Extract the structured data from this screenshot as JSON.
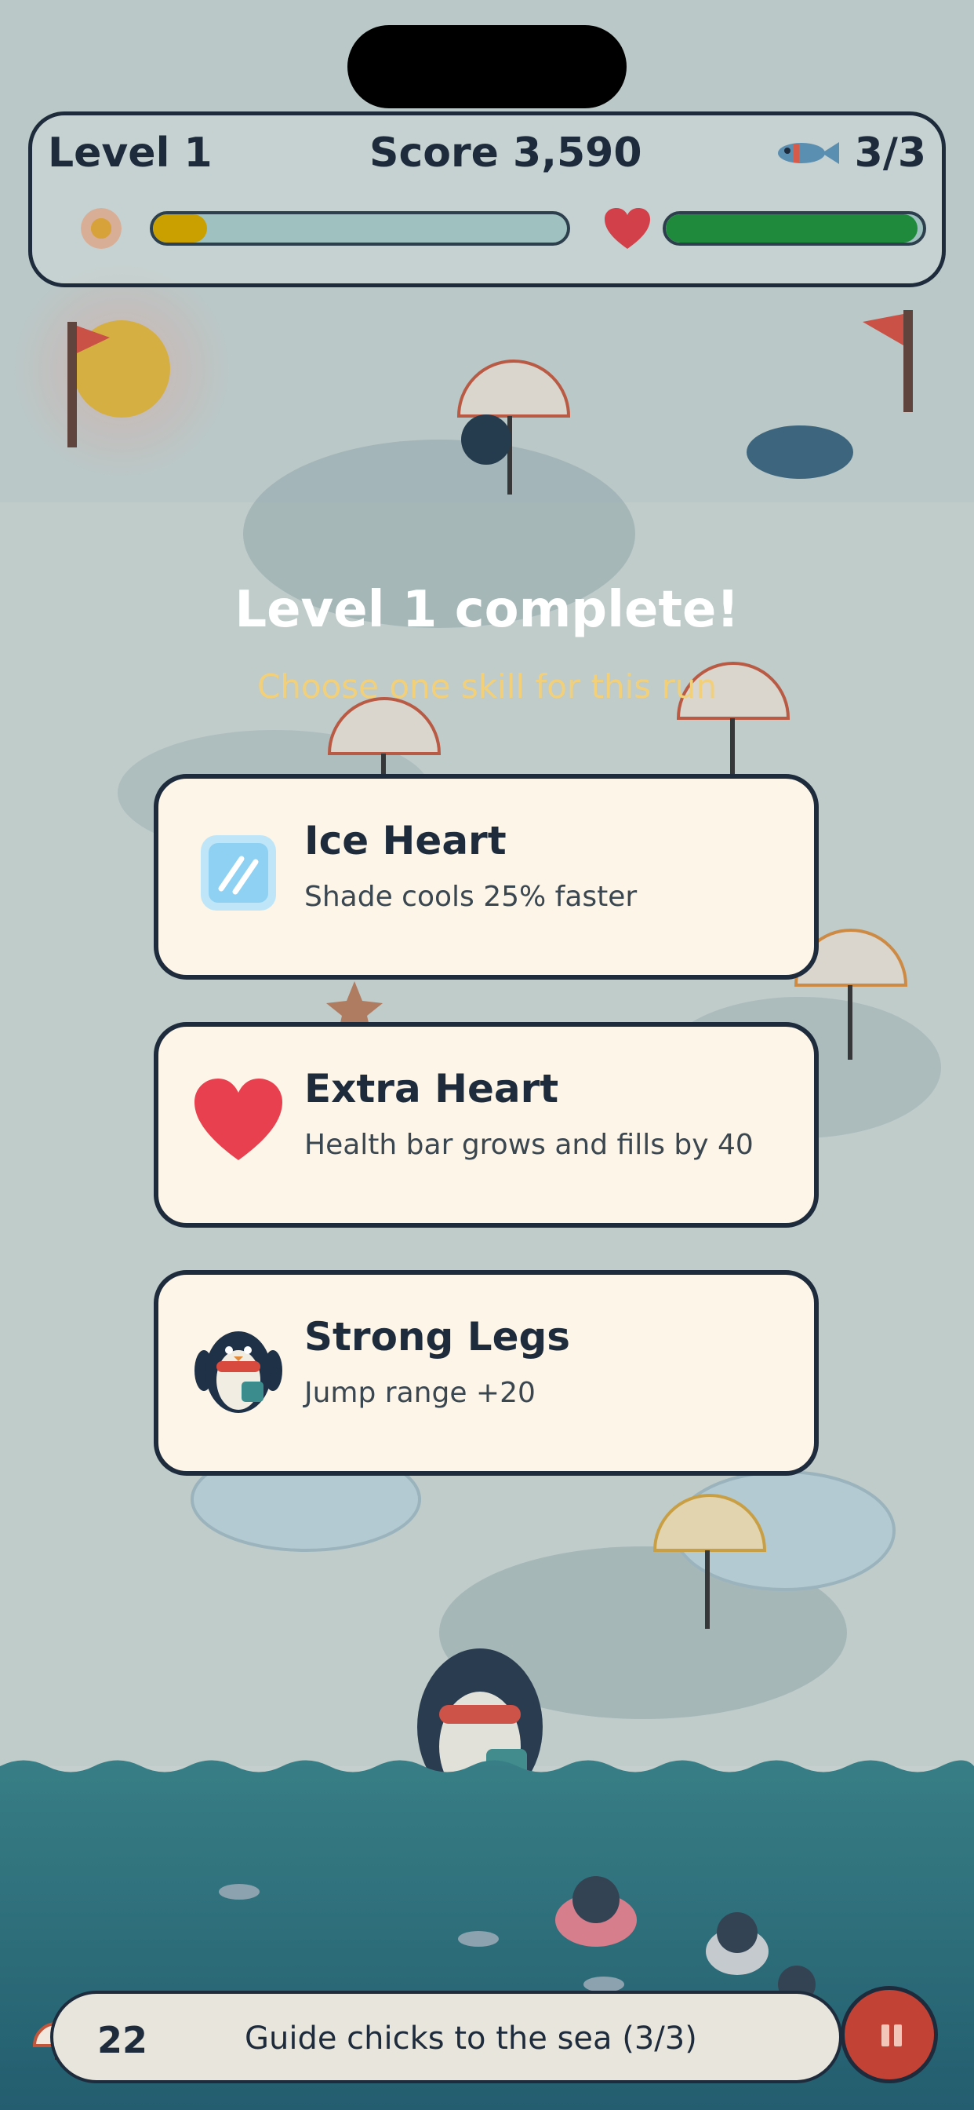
{
  "hud": {
    "level_label": "Level 1",
    "score_label": "Score 3,590",
    "fish_count": "3/3",
    "heat_level": 0.13,
    "health_level": 0.98,
    "heat_color": "#c9a000",
    "health_color": "#1f8a3c"
  },
  "overlay": {
    "title": "Level 1 complete!",
    "subtitle": "Choose one skill for this run"
  },
  "skills": [
    {
      "icon": "ice-icon",
      "name": "Ice Heart",
      "description": "Shade cools 25% faster"
    },
    {
      "icon": "heart-icon",
      "name": "Extra Heart",
      "description": "Health bar grows and fills by 40"
    },
    {
      "icon": "penguin-icon",
      "name": "Strong Legs",
      "description": "Jump range +20"
    }
  ],
  "bottom_bar": {
    "umbrella_count": "22",
    "objective": "Guide chicks to the sea (3/3)"
  },
  "colors": {
    "accent_dark": "#1d2b3c",
    "card_bg": "#fdf5e7",
    "subtitle_gold": "#f2d07a",
    "heart_red": "#e8404f",
    "pause_red": "#c34236"
  }
}
